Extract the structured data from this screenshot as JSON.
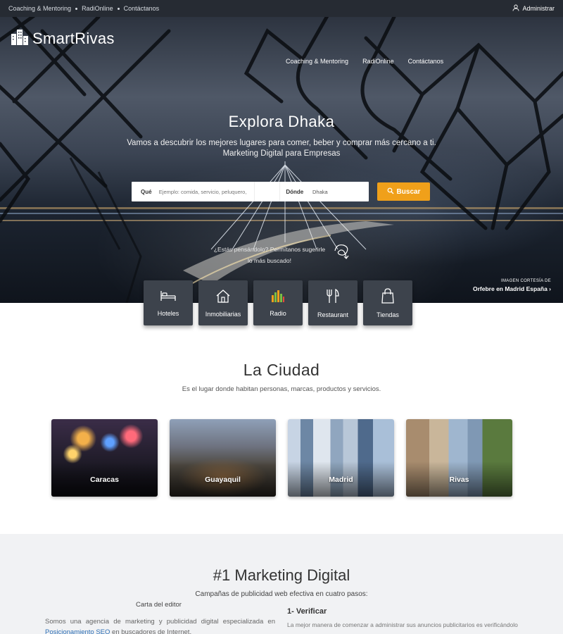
{
  "topbar": {
    "links": [
      "Coaching & Mentoring",
      "RadiOnline",
      "Contáctanos"
    ],
    "admin_label": "Administrar"
  },
  "brand": {
    "name": "SmartRivas"
  },
  "hero": {
    "nav": [
      "Coaching & Mentoring",
      "RadiOnline",
      "Contáctanos"
    ],
    "title": "Explora Dhaka",
    "subtitle_line1": "Vamos a descubrir los mejores lugares para comer, beber y comprar más cercano a ti.",
    "subtitle_line2": "Marketing Digital para Empresas",
    "search": {
      "what_label": "Qué",
      "what_placeholder": "Ejemplo: comida, servicio, peluquero,",
      "where_label": "Dónde",
      "where_value": "Dhaka",
      "button_label": "Buscar"
    },
    "suggest_line1": "¿Estás pensándolo? Permítanos sugerirle",
    "suggest_line2": "lo más buscado!",
    "credit_line1": "IMAGEN CORTESÍA DE",
    "credit_line2": "Orfebre en Madrid España ›"
  },
  "categories": [
    {
      "label": "Hoteles",
      "icon": "bed-icon"
    },
    {
      "label": "Inmobiliarias",
      "icon": "house-icon"
    },
    {
      "label": "Radio",
      "icon": "equalizer-icon"
    },
    {
      "label": "Restaurant",
      "icon": "cutlery-icon"
    },
    {
      "label": "Tiendas",
      "icon": "shopping-bag-icon"
    }
  ],
  "ciudad": {
    "title": "La Ciudad",
    "subtitle": "Es el lugar donde habitan personas, marcas, productos y servicios.",
    "cities": [
      "Caracas",
      "Guayaquil",
      "Madrid",
      "Rivas"
    ]
  },
  "marketing": {
    "title": "#1 Marketing Digital",
    "subtitle": "Campañas de publicidad web efectiva en cuatro pasos:",
    "carta_title": "Carta del editor",
    "para_text": "Somos una agencia de marketing y publicidad digital especializada en",
    "para_link": "Posicionamiento SEO",
    "para_tail": " en buscadores de Internet.",
    "step1_title": "1- Verificar",
    "step1_text": "La mejor manera de comenzar a administrar sus anuncios publicitarios es verificándolo"
  },
  "colors": {
    "topbar": "#262b33",
    "accent": "#f0a01a",
    "category_tile": "#3d434c",
    "link": "#2d6fb5",
    "section_bg": "#f1f2f4"
  }
}
